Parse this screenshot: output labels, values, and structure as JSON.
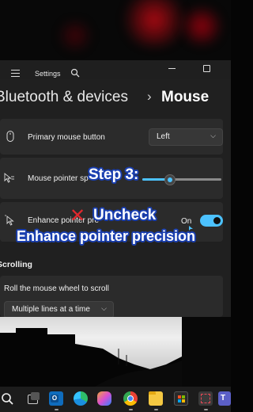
{
  "window": {
    "title": "Settings",
    "minimize_glyph": "—",
    "maximize_glyph": "□"
  },
  "breadcrumb": {
    "parent": "Bluetooth & devices",
    "separator": "›",
    "current": "Mouse"
  },
  "rows": [
    {
      "label": "Primary mouse button",
      "value": "Left",
      "icon": "mouse-icon"
    },
    {
      "label": "Mouse pointer speed",
      "visible_label": "Mouse pointer sp",
      "icon": "pointer-speed-icon",
      "slider_value": 0.34
    },
    {
      "label": "Enhance pointer precision",
      "visible_label": "Enhance pointer pre",
      "state": "On",
      "icon": "pointer-precision-icon"
    }
  ],
  "scrolling": {
    "section_title": "Scrolling",
    "row_label": "Roll the mouse wheel to scroll",
    "value": "Multiple lines at a time"
  },
  "overlay": {
    "step": "Step 3:",
    "uncheck": "Uncheck",
    "instruction": "Enhance pointer precision"
  },
  "taskbar": {
    "icons": [
      "search-icon",
      "task-view-icon",
      "outlook-icon",
      "edge-icon",
      "copilot-icon",
      "chrome-icon",
      "file-explorer-icon",
      "store-icon",
      "snipping-tool-icon",
      "teams-icon"
    ]
  },
  "colors": {
    "accent": "#4cc2ff",
    "card": "#2b2b2b",
    "background": "#202020",
    "overlay_outline": "#1a3fb0",
    "x_mark": "#e0282e"
  }
}
